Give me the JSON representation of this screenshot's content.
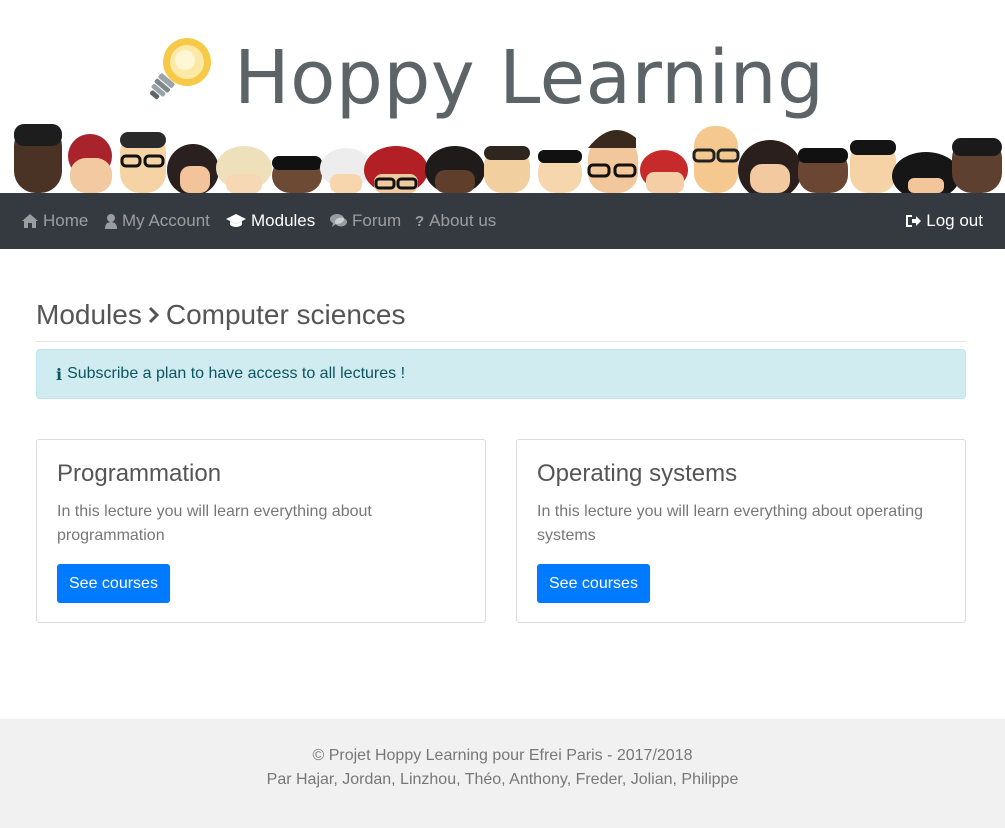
{
  "header": {
    "site_title": "Hoppy Learning",
    "logo_icon": "lightbulb-icon",
    "banner_art": "cartoon-faces-illustration"
  },
  "nav": {
    "items": [
      {
        "label": "Home",
        "icon": "home-icon",
        "active": false
      },
      {
        "label": "My Account",
        "icon": "user-icon",
        "active": false
      },
      {
        "label": "Modules",
        "icon": "graduation-cap-icon",
        "active": true
      },
      {
        "label": "Forum",
        "icon": "comments-icon",
        "active": false
      },
      {
        "label": "About us",
        "icon": "question-icon",
        "active": false
      }
    ],
    "logout": {
      "label": "Log out",
      "icon": "sign-out-icon"
    }
  },
  "breadcrumb": {
    "root": "Modules",
    "current": "Computer sciences"
  },
  "alert": {
    "icon": "info-icon",
    "text": "Subscribe a plan to have access to all lectures !"
  },
  "modules": [
    {
      "title": "Programmation",
      "description": "In this lecture you will learn everything about programmation",
      "button": "See courses"
    },
    {
      "title": "Operating systems",
      "description": "In this lecture you will learn everything about operating systems",
      "button": "See courses"
    }
  ],
  "footer": {
    "line1": "© Projet Hoppy Learning pour Efrei Paris - 2017/2018",
    "line2": "Par Hajar, Jordan, Linzhou, Théo, Anthony, Freder, Jolian, Philippe"
  },
  "colors": {
    "navbar": "#343a40",
    "primary": "#007bff",
    "alert_bg": "#d1ecf1",
    "alert_text": "#0c5460",
    "footer_bg": "#f1f1f1"
  }
}
